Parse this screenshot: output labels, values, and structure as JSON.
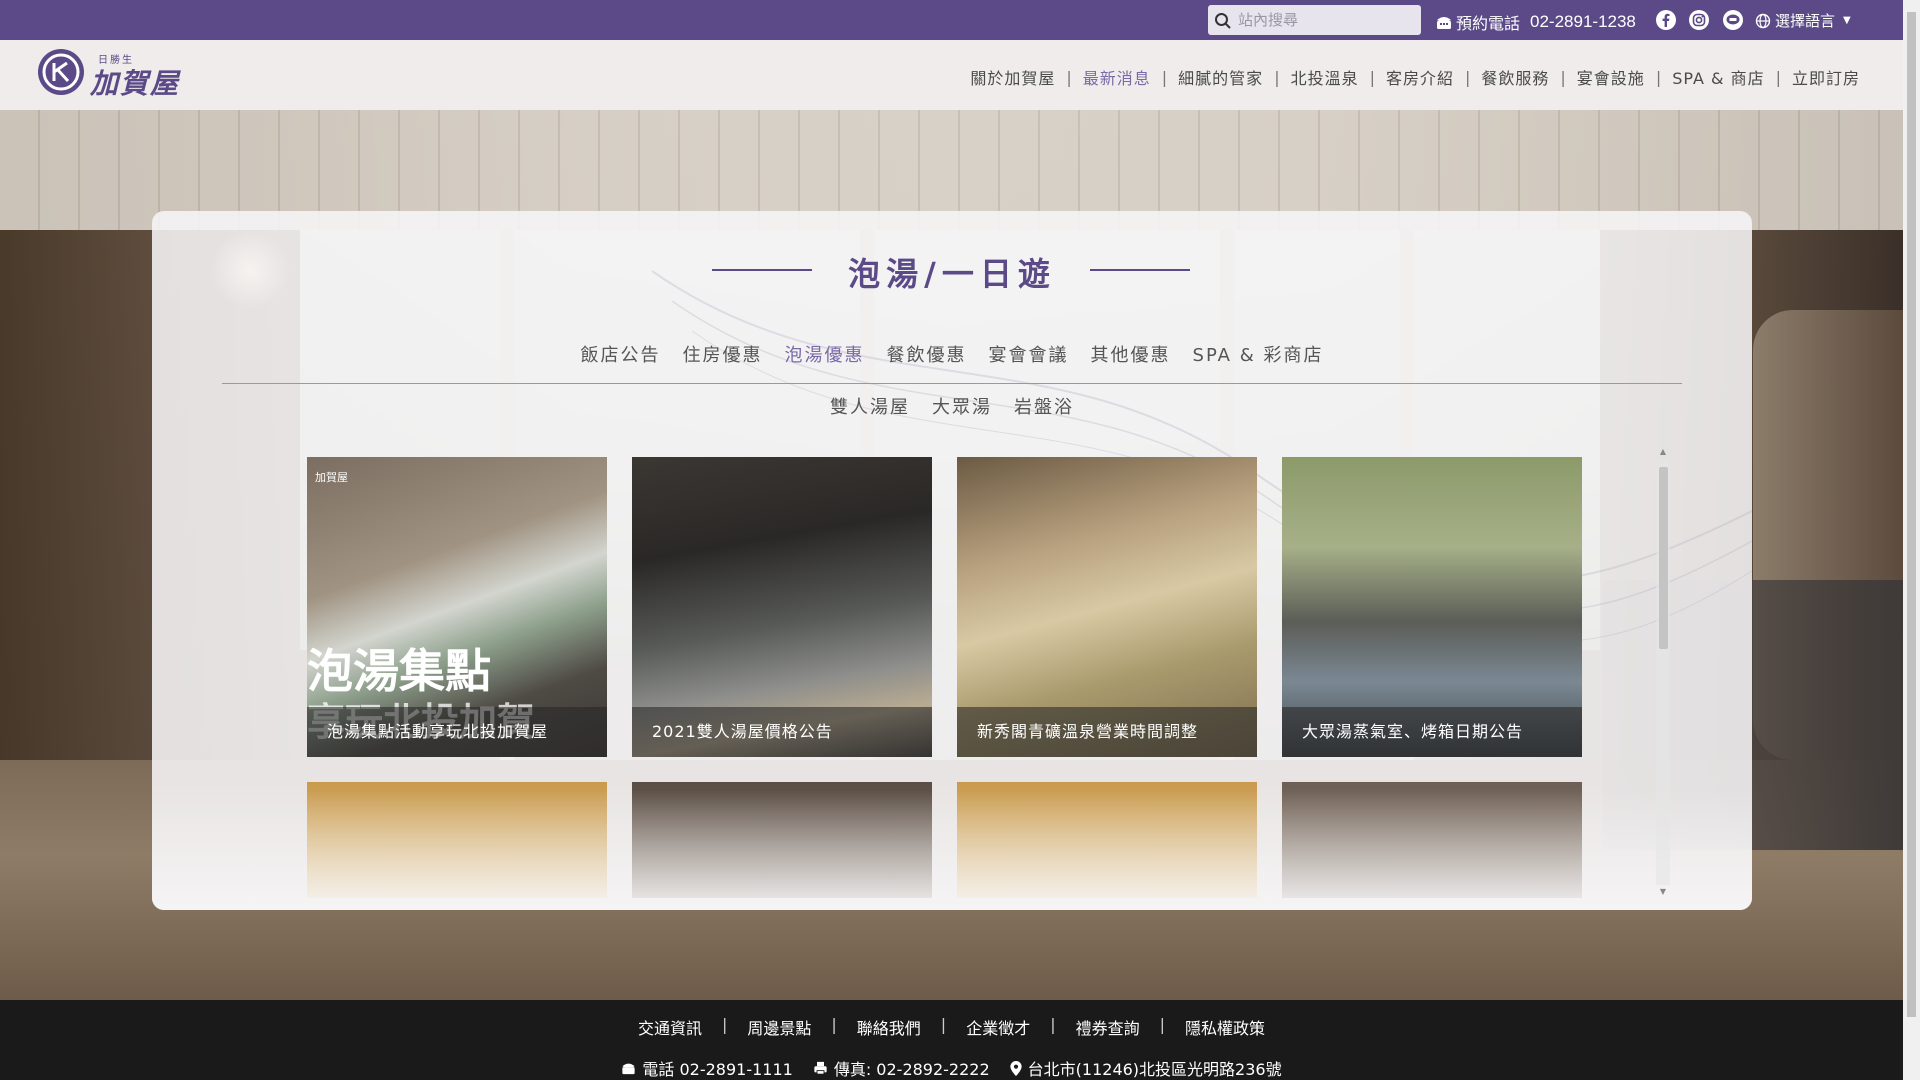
{
  "topbar": {
    "search_placeholder": "站內搜尋",
    "booking_label": "預約電話",
    "booking_phone": "02-2891-1238",
    "social_icons": [
      "facebook-icon",
      "instagram-icon",
      "line-icon"
    ],
    "language_label": "選擇語言"
  },
  "header": {
    "logo_small": "日勝生",
    "logo_text": "加賀屋",
    "nav": [
      {
        "label": "關於加賀屋",
        "active": false
      },
      {
        "label": "最新消息",
        "active": true
      },
      {
        "label": "細膩的管家",
        "active": false
      },
      {
        "label": "北投溫泉",
        "active": false
      },
      {
        "label": "客房介紹",
        "active": false
      },
      {
        "label": "餐飲服務",
        "active": false
      },
      {
        "label": "宴會設施",
        "active": false
      },
      {
        "label": "SPA & 商店",
        "active": false
      },
      {
        "label": "立即訂房",
        "active": false
      }
    ]
  },
  "main": {
    "title": "泡湯/一日遊",
    "tabs": [
      {
        "label": "飯店公告",
        "active": false
      },
      {
        "label": "住房優惠",
        "active": false
      },
      {
        "label": "泡湯優惠",
        "active": true
      },
      {
        "label": "餐飲優惠",
        "active": false
      },
      {
        "label": "宴會會議",
        "active": false
      },
      {
        "label": "其他優惠",
        "active": false
      },
      {
        "label": "SPA & 彩商店",
        "active": false
      }
    ],
    "subtabs": [
      "雙人湯屋",
      "大眾湯",
      "岩盤浴"
    ],
    "cards": [
      {
        "caption": "泡湯集點活動享玩北投加賀屋",
        "overlay_line1": "泡湯集點",
        "overlay_line2": "享玩北投加賀",
        "logo_text": "加賀屋"
      },
      {
        "caption": "2021雙人湯屋價格公告"
      },
      {
        "caption": "新秀閣青礦溫泉營業時間調整"
      },
      {
        "caption": "大眾湯蒸氣室、烤箱日期公告"
      },
      {
        "caption": ""
      },
      {
        "caption": ""
      },
      {
        "caption": ""
      },
      {
        "caption": ""
      }
    ]
  },
  "footer": {
    "links": [
      "交通資訊",
      "周邊景點",
      "聯絡我們",
      "企業徵才",
      "禮券查詢",
      "隱私權政策"
    ],
    "phone_label": "電話 02-2891-1111",
    "fax_label": "傳真: 02-2892-2222",
    "address": "台北市(11246)北投區光明路236號"
  },
  "colors": {
    "brand_purple": "#5b4a87",
    "active_nav": "#7a6aa6",
    "footer_bg": "#1a1a1a"
  }
}
